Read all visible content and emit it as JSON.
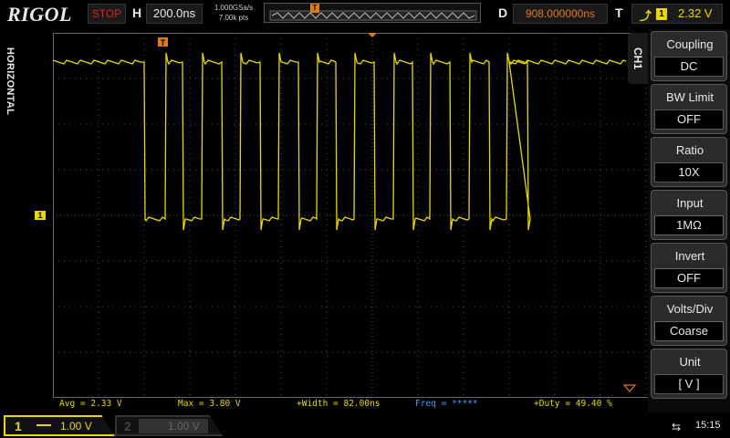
{
  "top": {
    "brand": "RIGOL",
    "run_state": "STOP",
    "h_label": "H",
    "h_scale": "200.0ns",
    "sample_rate": "1.000GSa/s",
    "memory_depth": "7.00k pts",
    "trigger_marker": "T",
    "d_label": "D",
    "d_offset": "908.000000ns",
    "t_label": "T",
    "trigger_edge_icon": "rising-edge-icon",
    "trigger_channel": "1",
    "trigger_level": "2.32 V",
    "colors": {
      "run_state": "#e02020",
      "d_offset": "#e07a1a",
      "trigger": "#e8d800"
    }
  },
  "left_tab": {
    "label": "HORIZONTAL"
  },
  "waveform": {
    "channel_marker": "1",
    "trace_color": "#e8d800",
    "trigger_position_marker": "T"
  },
  "measurements": {
    "avg": "Avg = 2.33 V",
    "max": "Max = 3.80 V",
    "width": "+Width = 82.00ns",
    "freq": "Freq = *****",
    "duty": "+Duty = 49.40 %"
  },
  "bottom": {
    "ch1_number": "1",
    "ch1_scale": "1.00 V",
    "ch2_number": "2",
    "ch2_scale": "1.00 V",
    "usb_icon": "usb-icon",
    "time": "15:15"
  },
  "menu": {
    "tab_label": "CH1",
    "items": [
      {
        "title": "Coupling",
        "value": "DC",
        "arrow": "◀"
      },
      {
        "title": "BW Limit",
        "value": "OFF",
        "arrow": "◀"
      },
      {
        "title": "Ratio",
        "value": "10X",
        "arrow": "◀"
      },
      {
        "title": "Input",
        "value": "1MΩ",
        "arrow": ""
      },
      {
        "title": "Invert",
        "value": "OFF",
        "arrow": ""
      },
      {
        "title": "Volts/Div",
        "value": "Coarse",
        "arrow": ""
      },
      {
        "title": "Unit",
        "value": "[  V  ]",
        "arrow": "◀"
      }
    ]
  }
}
